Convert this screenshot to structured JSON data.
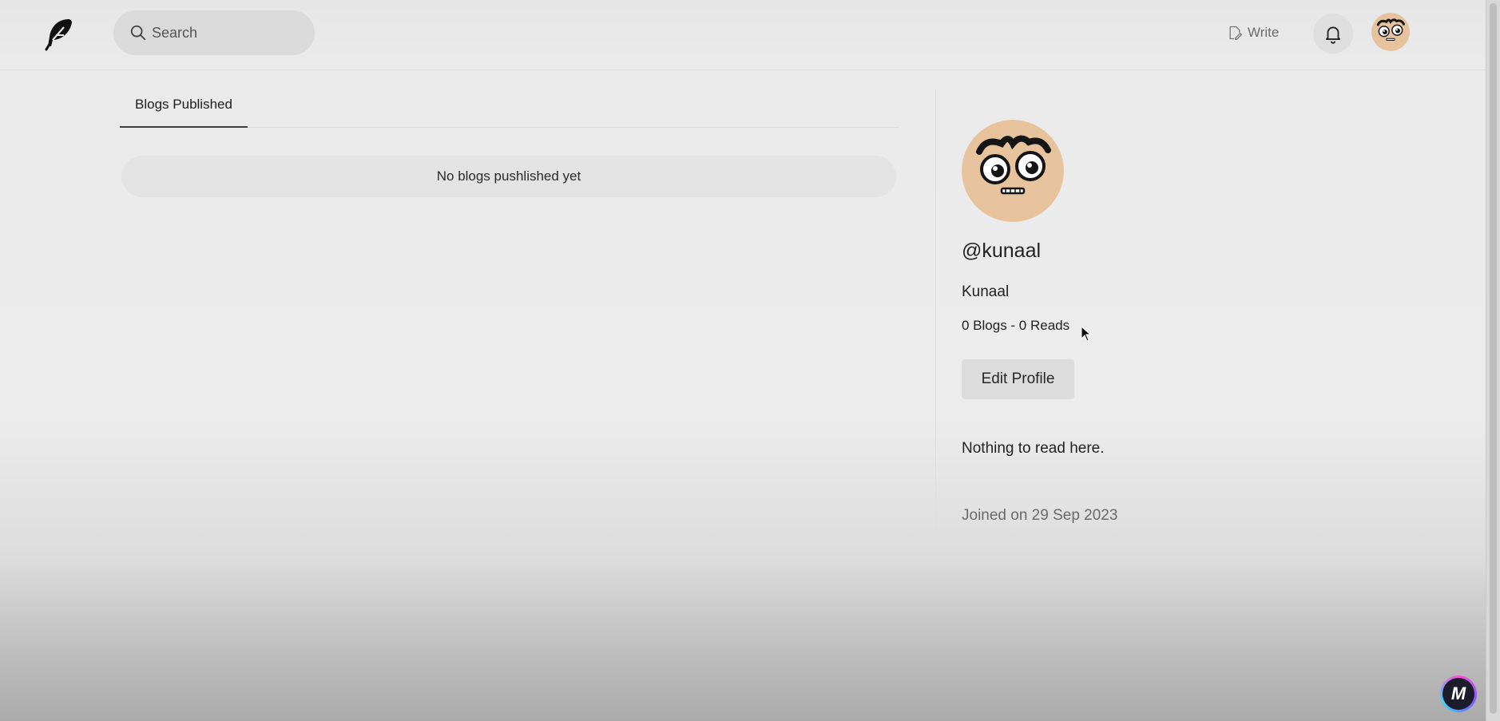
{
  "navbar": {
    "logo_icon": "feather-icon",
    "search": {
      "placeholder": "Search",
      "icon": "search-icon"
    },
    "write_label": "Write",
    "write_icon": "file-edit-icon",
    "bell_icon": "bell-icon",
    "avatar_icon": "cartoon-face-avatar"
  },
  "main": {
    "tabs": [
      {
        "label": "Blogs Published"
      }
    ],
    "empty_message": "No blogs pushlished yet"
  },
  "profile": {
    "username": "@kunaal",
    "full_name": "Kunaal",
    "stats": "0 Blogs - 0 Reads",
    "edit_label": "Edit Profile",
    "bio": "Nothing to read here.",
    "joined": "Joined on 29 Sep 2023"
  },
  "overlay": {
    "badge_letter": "M"
  },
  "colors": {
    "avatar_skin": "#e6c39d",
    "button_bg": "#dcdcdc",
    "muted_text": "#6a6a6a"
  }
}
